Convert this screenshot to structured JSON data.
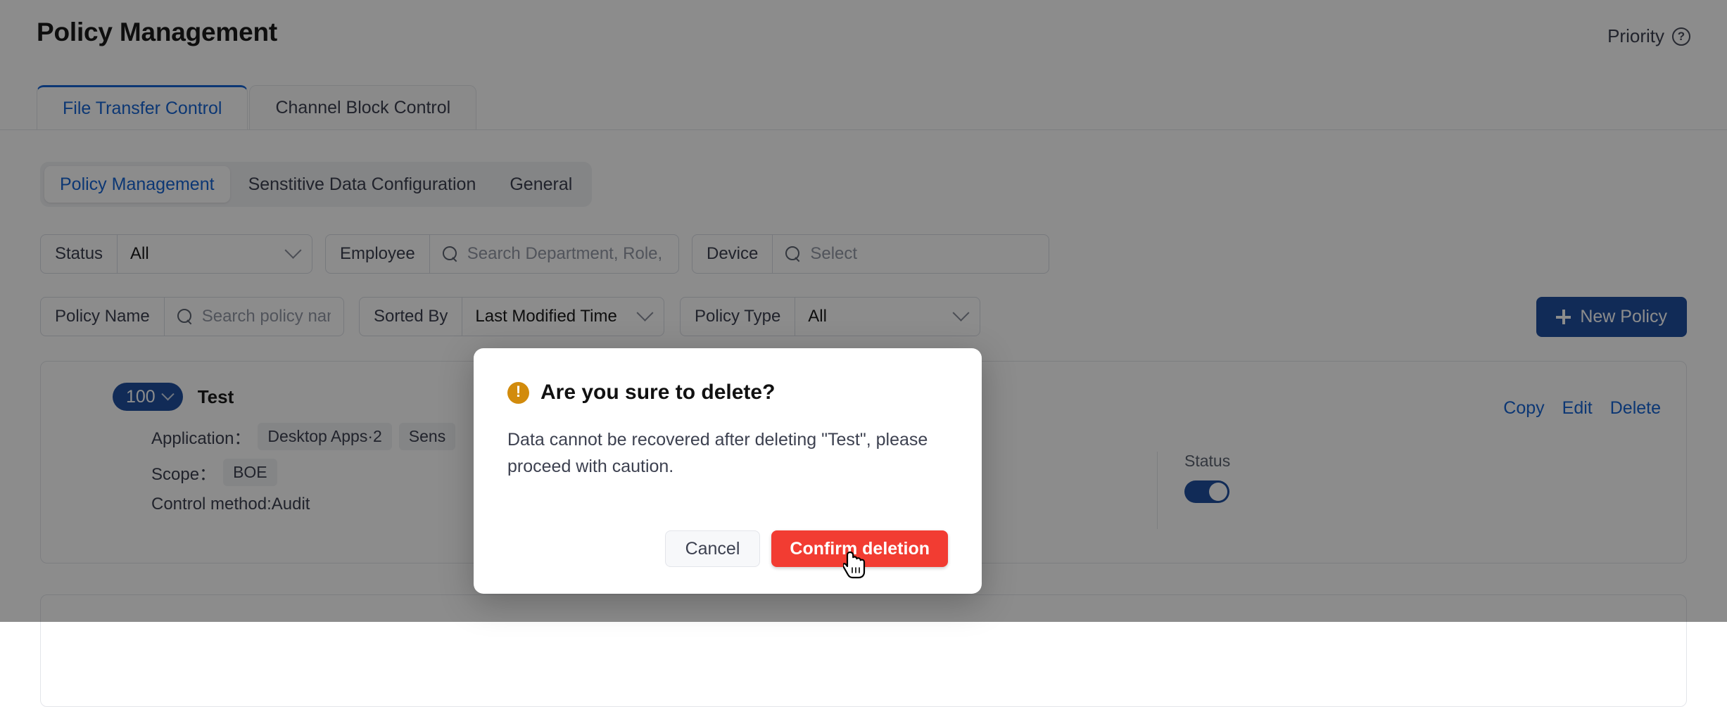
{
  "header": {
    "title": "Policy Management",
    "priority_label": "Priority",
    "help_icon": "question-circle-icon",
    "help_glyph": "?"
  },
  "top_tabs": [
    {
      "label": "File Transfer Control",
      "active": true
    },
    {
      "label": "Channel Block Control",
      "active": false
    }
  ],
  "segmented": [
    {
      "label": "Policy Management",
      "active": true
    },
    {
      "label": "Senstitive Data Configuration",
      "active": false
    },
    {
      "label": "General",
      "active": false
    }
  ],
  "filters": {
    "status": {
      "label": "Status",
      "value": "All",
      "icon": "chevron-down-icon"
    },
    "employee": {
      "label": "Employee",
      "placeholder": "Search Department, Role, Membe",
      "icon": "search-icon"
    },
    "device": {
      "label": "Device",
      "placeholder": "Select",
      "icon": "search-icon"
    },
    "policy_name": {
      "label": "Policy Name",
      "placeholder": "Search policy name",
      "icon": "search-icon"
    },
    "sorted_by": {
      "label": "Sorted By",
      "value": "Last Modified Time",
      "icon": "chevron-down-icon"
    },
    "policy_type": {
      "label": "Policy Type",
      "value": "All",
      "icon": "chevron-down-icon"
    }
  },
  "new_policy_button": {
    "label": "New Policy",
    "icon": "plus-icon",
    "color": "#1f4f9e"
  },
  "policy_cards": [
    {
      "priority": "100",
      "name": "Test",
      "application_label": "Application：",
      "application_tags": [
        "Desktop Apps·2",
        "Sens"
      ],
      "scope_label": "Scope：",
      "scope_tags": [
        "BOE"
      ],
      "control_method": "Control method:Audit",
      "actions": [
        "Copy",
        "Edit",
        "Delete"
      ],
      "status_label": "Status",
      "status_on": true
    }
  ],
  "modal": {
    "icon": "warning-icon",
    "icon_glyph": "!",
    "icon_color": "#d28b0c",
    "title": "Are you sure to delete?",
    "body": "Data cannot be recovered after deleting \"Test\", please proceed with caution.",
    "cancel_label": "Cancel",
    "confirm_label": "Confirm deletion",
    "confirm_color": "#f23c32"
  },
  "cursor": {
    "icon": "pointing-hand-cursor"
  },
  "colors": {
    "accent_blue": "#1664d4",
    "brand_blue": "#1f4f9e",
    "danger_red": "#f23c32",
    "warning_amber": "#d28b0c",
    "overlay": "rgba(0,0,0,0.45)"
  }
}
